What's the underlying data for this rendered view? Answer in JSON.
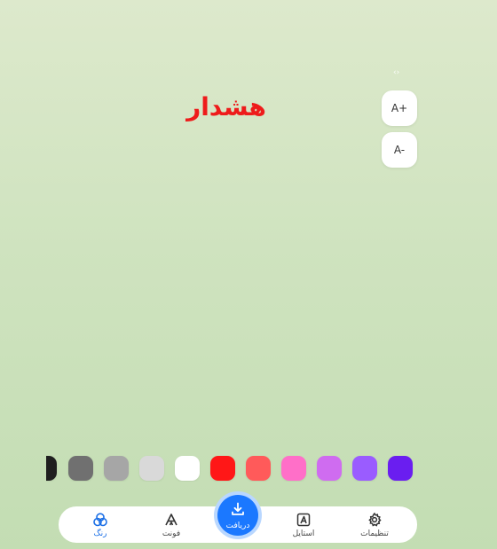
{
  "top_hint": "‹›",
  "font_size": {
    "increase_label": "A+",
    "decrease_label": "A-"
  },
  "preview": {
    "text": "هشدار",
    "text_color": "#ee1b1b"
  },
  "palette": {
    "colors": [
      "#1f1f1f",
      "#707070",
      "#a6a6a6",
      "#d9d9d9",
      "#ffffff",
      "#ff1717",
      "#ff5a5a",
      "#ff6fc8",
      "#cf6cf0",
      "#9a5cff",
      "#6a1ef0"
    ]
  },
  "bottom_nav": {
    "color_label": "رنگ",
    "font_label": "فونت",
    "download_label": "دریافت",
    "style_label": "استایل",
    "settings_label": "تنظیمات"
  }
}
